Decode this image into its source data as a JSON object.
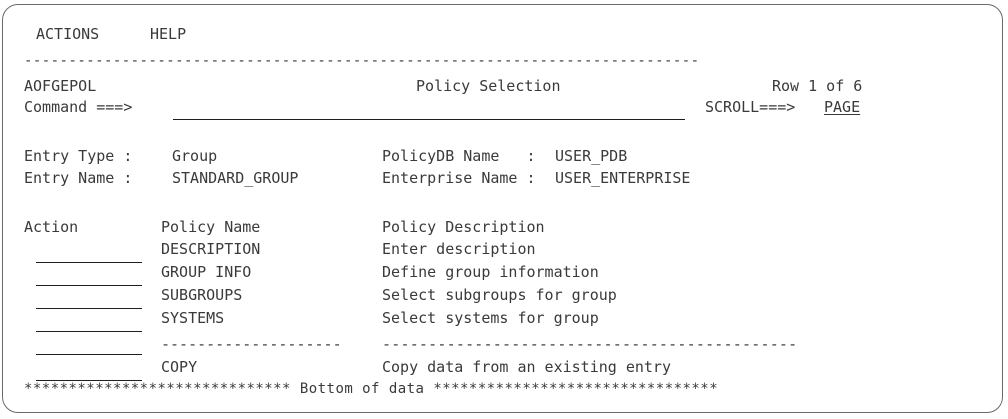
{
  "menu": {
    "actions": "ACTIONS",
    "help": "HELP"
  },
  "separator": "----------------------------------------------------------------------------",
  "panel": {
    "id": "AOFGEPOL",
    "title": "Policy Selection",
    "row_info": "Row 1 of 6"
  },
  "command": {
    "label": "Command ===>",
    "value": ""
  },
  "scroll": {
    "label": "SCROLL===>",
    "value": "PAGE"
  },
  "entry": {
    "type_label": "Entry Type :",
    "type_value": "Group",
    "name_label": "Entry Name :",
    "name_value": "STANDARD_GROUP",
    "policydb_label": "PolicyDB Name   :",
    "policydb_value": "USER_PDB",
    "enterprise_label": "Enterprise Name :",
    "enterprise_value": "USER_ENTERPRISE"
  },
  "table": {
    "headers": {
      "action": "Action",
      "name": "Policy Name",
      "description": "Policy Description"
    },
    "rows": [
      {
        "name": "DESCRIPTION",
        "description": "Enter description"
      },
      {
        "name": "GROUP INFO",
        "description": "Define group information"
      },
      {
        "name": "SUBGROUPS",
        "description": "Select subgroups for group"
      },
      {
        "name": "SYSTEMS",
        "description": "Select systems for group"
      },
      {
        "name": "--------------------",
        "description": "---------------------------------------------"
      },
      {
        "name": "COPY",
        "description": "Copy data from an existing entry"
      }
    ]
  },
  "footer": "****************************** Bottom of data ********************************"
}
